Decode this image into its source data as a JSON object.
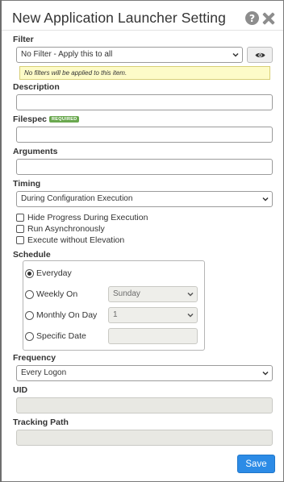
{
  "dialog": {
    "title": "New Application Launcher Setting",
    "save_label": "Save"
  },
  "filter": {
    "label": "Filter",
    "selected": "No Filter - Apply this to all",
    "hint": "No filters will be applied to this item."
  },
  "description": {
    "label": "Description",
    "value": ""
  },
  "filespec": {
    "label": "Filespec",
    "badge": "REQUIRED",
    "value": ""
  },
  "arguments": {
    "label": "Arguments",
    "value": ""
  },
  "timing": {
    "label": "Timing",
    "selected": "During Configuration Execution",
    "options": [
      {
        "label": "Hide Progress During Execution",
        "checked": false
      },
      {
        "label": "Run Asynchronously",
        "checked": false
      },
      {
        "label": "Execute without Elevation",
        "checked": false
      }
    ]
  },
  "schedule": {
    "label": "Schedule",
    "everyday": {
      "label": "Everyday",
      "checked": true
    },
    "weekly": {
      "label": "Weekly On",
      "checked": false,
      "selected": "Sunday"
    },
    "monthly": {
      "label": "Monthly On Day",
      "checked": false,
      "selected": "1"
    },
    "specific": {
      "label": "Specific Date",
      "checked": false,
      "value": ""
    }
  },
  "frequency": {
    "label": "Frequency",
    "selected": "Every Logon"
  },
  "uid": {
    "label": "UID",
    "value": ""
  },
  "tracking_path": {
    "label": "Tracking Path",
    "value": ""
  },
  "icons": [
    "help-icon",
    "close-icon",
    "eye-icon",
    "chevron-down-icon"
  ]
}
